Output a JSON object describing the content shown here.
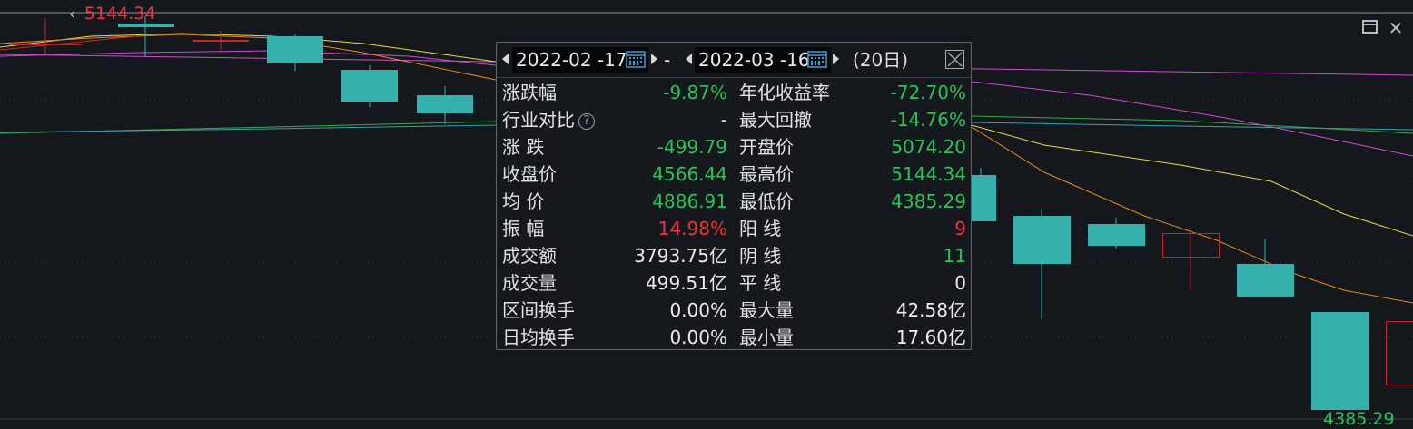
{
  "chart": {
    "high_price_label": "5144.34",
    "low_price_label": "4385.29",
    "colors": {
      "background": "#14171c",
      "grid": "#3a4048",
      "candle_down": "#35b0ad",
      "candle_up": "#c0282e",
      "ma_yellow": "#e9d84a",
      "ma_orange": "#e58a1f",
      "ma_magenta": "#d04ad0",
      "ma_green": "#3ca94a",
      "ma_cyan": "#3a9fb0",
      "text_red": "#f0343c",
      "text_green": "#2bc25a"
    }
  },
  "popup": {
    "start_date": "2022-02 -17",
    "separator": "-",
    "end_date": "2022-03 -16",
    "day_count": "(20日)",
    "icons": {
      "prev": "triangle-left-icon",
      "next": "triangle-right-icon",
      "calendar": "calendar-icon",
      "close": "close-box-icon",
      "help": "question-circle-icon"
    },
    "rows": [
      {
        "l1": "涨跌幅",
        "v1": "-9.87%",
        "c1": "green",
        "l2": "年化收益率",
        "v2": "-72.70%",
        "c2": "green"
      },
      {
        "l1": "行业对比",
        "v1": "-",
        "c1": "white",
        "l2": "最大回撤",
        "v2": "-14.76%",
        "c2": "green",
        "help": "?"
      },
      {
        "l1": "涨 跌",
        "v1": "-499.79",
        "c1": "green",
        "l2": "开盘价",
        "v2": "5074.20",
        "c2": "green"
      },
      {
        "l1": "收盘价",
        "v1": "4566.44",
        "c1": "green",
        "l2": "最高价",
        "v2": "5144.34",
        "c2": "green"
      },
      {
        "l1": "均 价",
        "v1": "4886.91",
        "c1": "green",
        "l2": "最低价",
        "v2": "4385.29",
        "c2": "green"
      },
      {
        "l1": "振 幅",
        "v1": "14.98%",
        "c1": "red",
        "l2": "阳 线",
        "v2": "9",
        "c2": "red"
      },
      {
        "l1": "成交额",
        "v1": "3793.75亿",
        "c1": "white",
        "l2": "阴 线",
        "v2": "11",
        "c2": "green"
      },
      {
        "l1": "成交量",
        "v1": "499.51亿",
        "c1": "white",
        "l2": "平 线",
        "v2": "0",
        "c2": "white"
      },
      {
        "l1": "区间换手",
        "v1": "0.00%",
        "c1": "white",
        "l2": "最大量",
        "v2": "42.58亿",
        "c2": "white"
      },
      {
        "l1": "日均换手",
        "v1": "0.00%",
        "c1": "white",
        "l2": "最小量",
        "v2": "17.60亿",
        "c2": "white"
      }
    ]
  }
}
